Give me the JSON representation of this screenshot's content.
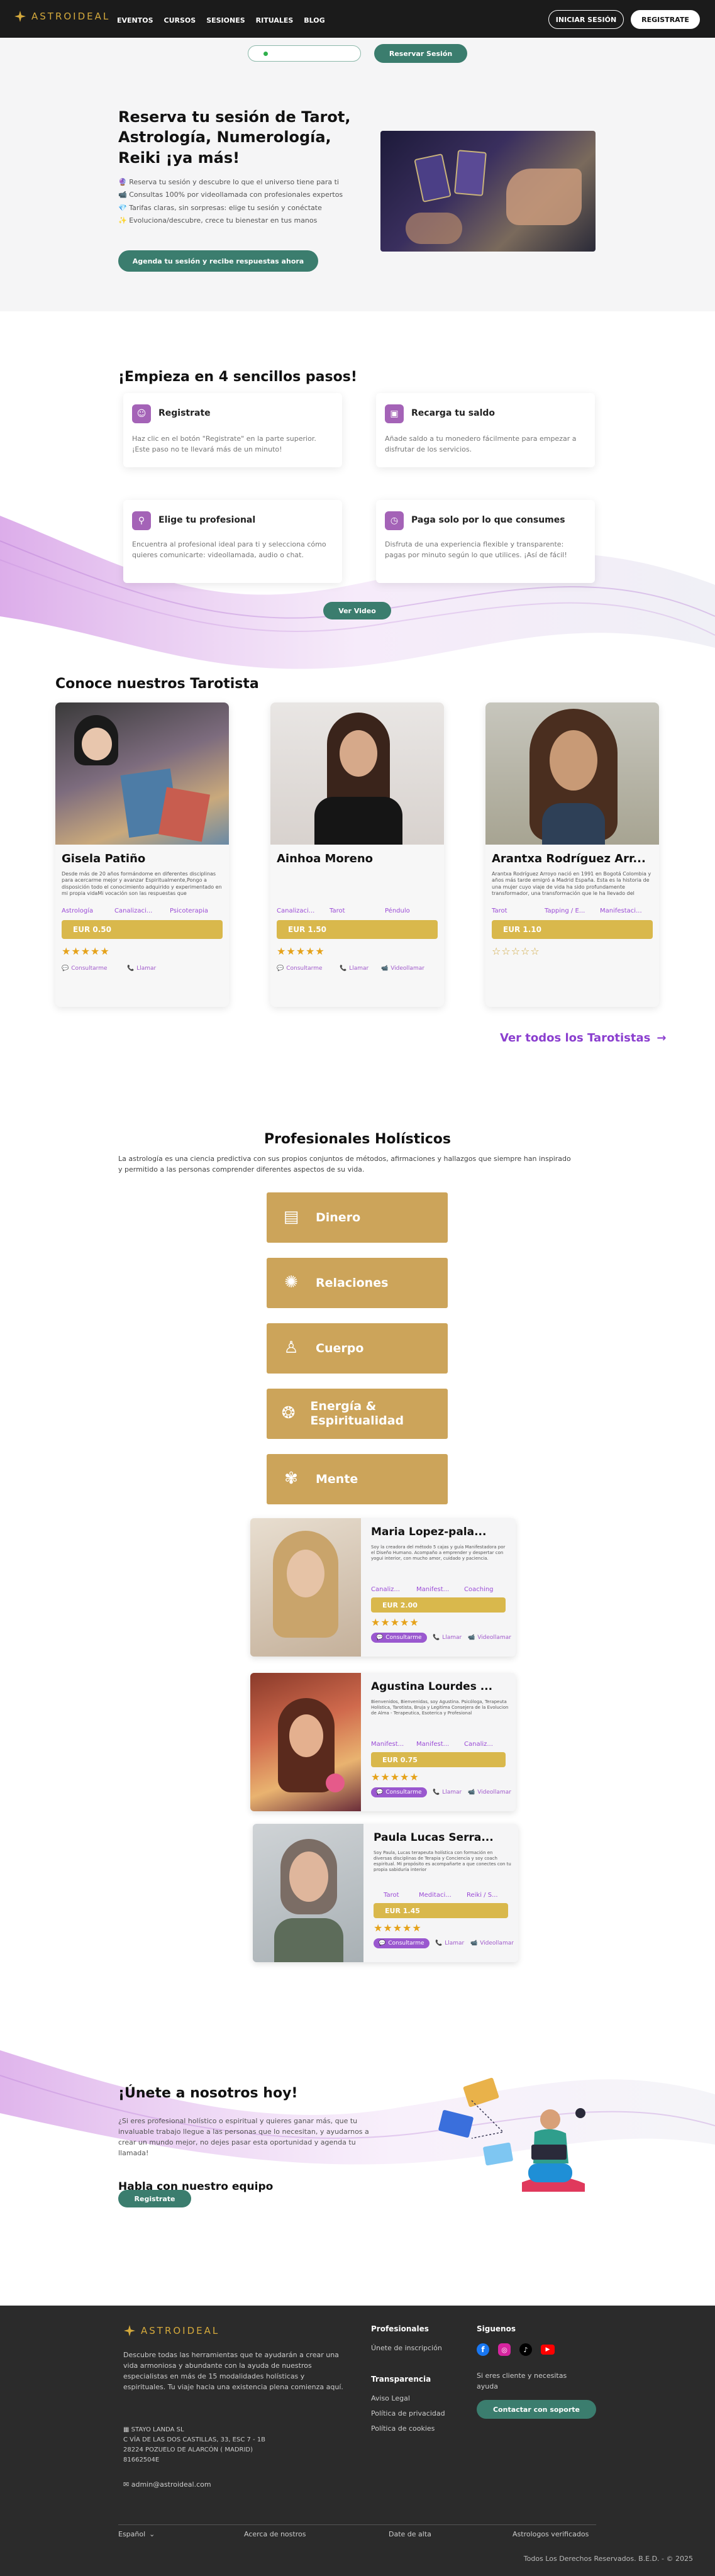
{
  "header": {
    "logo": "ASTROIDEAL",
    "nav": [
      "EVENTOS",
      "CURSOS",
      "SESIONES",
      "RITUALES",
      "BLOG"
    ],
    "login": "INICIAR SESIÓN",
    "register": "REGISTRATE"
  },
  "hero": {
    "reserve_button": "Reservar Sesión",
    "title": "Reserva tu sesión de Tarot, Astrología, Numerología, Reiki ¡ya más!",
    "bullets": [
      "🔮 Reserva tu sesión y descubre lo que el universo tiene para ti",
      "📹 Consultas 100% por videollamada con profesionales expertos",
      "💎 Tarifas claras, sin sorpresas: elige tu sesión y conéctate",
      "✨ Evoluciona/descubre, crece tu bienestar en tus manos"
    ],
    "cta": "Agenda tu sesión y recibe respuestas ahora"
  },
  "steps": {
    "title": "¡Empieza en 4 sencillos pasos!",
    "items": [
      {
        "title": "Registrate",
        "desc": "Haz clic en el botón \"Registrate\" en la parte superior. ¡Este paso no te llevará más de un minuto!"
      },
      {
        "title": "Recarga tu saldo",
        "desc": "Añade saldo a tu monedero fácilmente para empezar a disfrutar de los servicios."
      },
      {
        "title": "Elige tu profesional",
        "desc": "Encuentra al profesional ideal para ti y selecciona cómo quieres comunicarte: videollamada, audio o chat."
      },
      {
        "title": "Paga solo por lo que consumes",
        "desc": "Disfruta de una experiencia flexible y transparente: pagas por minuto según lo que utilices. ¡Así de fácil!"
      }
    ],
    "video_button": "Ver Video"
  },
  "tarotistas": {
    "title": "Conoce nuestros Tarotista",
    "see_all": "Ver todos los Tarotistas",
    "cards": [
      {
        "name": "Gisela Patiño",
        "bio": "Desde más de 20 años formándome en diferentes disciplinas para acercarme mejor y avanzar Espiritualmente,Pongo a disposición todo el conocimiento adquirido y experimentado en mi propia vidaMi vocación son las respuestas que",
        "tags": [
          "Astrología",
          "Canalizaci...",
          "Psicoterapia"
        ],
        "price": "EUR 0.50",
        "actions": [
          "Consultarme",
          "Llamar"
        ]
      },
      {
        "name": "Ainhoa Moreno",
        "bio": "",
        "tags": [
          "Canalizaci...",
          "Tarot",
          "Péndulo"
        ],
        "price": "EUR 1.50",
        "actions": [
          "Consultarme",
          "Llamar",
          "Videollamar"
        ]
      },
      {
        "name": "Arantxa Rodríguez Arr...",
        "bio": "Arantxa Rodríguez Arroyo nació en 1991 en Bogotá Colombia y años más tarde emigró a Madrid España. Esta es la historia de una mujer cuyo viaje de vida ha sido profundamente transformador, una transformación que le ha llevado del",
        "tags": [
          "Tarot",
          "Tapping / E...",
          "Manifestaci..."
        ],
        "price": "EUR 1.10",
        "actions": []
      }
    ]
  },
  "holisticos": {
    "title": "Profesionales Holísticos",
    "intro": "La astrología es una ciencia predictiva con sus propios conjuntos de métodos, afirmaciones y hallazgos que siempre han inspirado y permitido a las personas comprender diferentes aspectos de su vida.",
    "categories": [
      "Dinero",
      "Relaciones",
      "Cuerpo",
      "Energía & Espiritualidad",
      "Mente"
    ],
    "pros": [
      {
        "name": "Maria Lopez-pala...",
        "bio": "Soy la creadora del método 5 cajas y guía Manifestadora por el Diseño Humano. Acompaño a emprender y despertar con yogui interior, con mucho amor, cuidado y paciencia.",
        "tags": [
          "Canaliz...",
          "Manifest...",
          "Coaching"
        ],
        "price": "EUR 2.00",
        "actions": [
          "Consultarme",
          "Llamar",
          "Videollamar"
        ]
      },
      {
        "name": "Agustina Lourdes ...",
        "bio": "Bienvenidos, Bienvenidas, soy Agustina. Psicóloga, Terapeuta Holística, Tarotista, Bruja y Legitima Consejera de la Evolucion de Alma - Terapeutica, Esoterica y Profesional",
        "tags": [
          "Manifest...",
          "Manifest...",
          "Canaliz..."
        ],
        "price": "EUR 0.75",
        "actions": [
          "Consultarme",
          "Llamar",
          "Videollamar"
        ]
      },
      {
        "name": "Paula Lucas Serra...",
        "bio": "Soy Paula, Lucas terapeuta holística con formación en diversas disciplinas de Terapia y Conciencia y soy coach espiritual. Mi propósito es acompañarte a que conectes con tu propia sabiduría interior",
        "tags": [
          "Tarot",
          "Meditaci...",
          "Reiki / S..."
        ],
        "price": "EUR 1.45",
        "actions": [
          "Consultarme",
          "Llamar",
          "Videollamar"
        ]
      }
    ]
  },
  "join": {
    "title": "¡Únete a nosotros hoy!",
    "desc": "¿Si eres profesional holístico o espiritual y quieres ganar más, que tu invaluable trabajo llegue a las personas que lo necesitan, y ayudarnos a crear un mundo mejor, no dejes pasar esta oportunidad y agenda tu llamada!",
    "subtitle": "Habla con nuestro equipo",
    "button": "Registrate"
  },
  "footer": {
    "logo": "ASTROIDEAL",
    "desc": "Descubre todas las herramientas que te ayudarán a crear una vida armoniosa y abundante con la ayuda de nuestros especialistas en más de 15 modalidades holísticas y espirituales. Tu viaje hacia una existencia plena comienza aquí.",
    "company": "STAYO LANDA SL",
    "address1": "C VÍA DE LAS DOS CASTILLAS, 33, ESC 7 - 1B",
    "address2": "28224 POZUELO DE ALARCÓN ( MADRID)",
    "phone": "81662504E",
    "email": "admin@astroideal.com",
    "col1_title": "Profesionales",
    "col1_links": [
      "Únete de inscripción"
    ],
    "col2_title": "Transparencia",
    "col2_links": [
      "Aviso Legal",
      "Política de privacidad",
      "Política de cookies"
    ],
    "col3_title": "Siguenos",
    "col3_text": "Si eres cliente y necesitas ayuda",
    "support": "Contactar con soporte",
    "bottom_links": [
      "Español",
      "Acerca de nostros",
      "Date de alta",
      "Astrologos verificados"
    ],
    "copyright": "Todos Los Derechos Reservados. B.E.D. - © 2025"
  }
}
